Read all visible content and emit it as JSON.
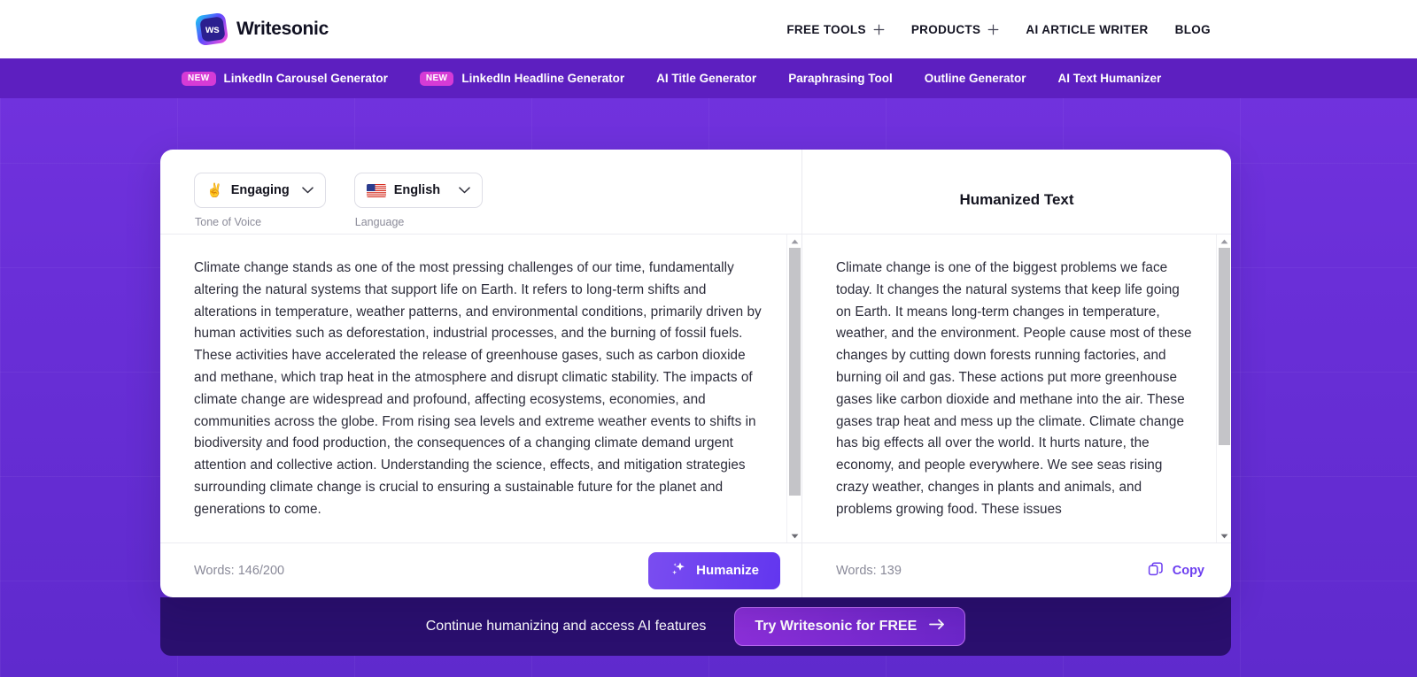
{
  "brand": {
    "name": "Writesonic",
    "logo_text": "ws",
    "logo_icon": "writesonic-logo-icon"
  },
  "topnav": {
    "items": [
      {
        "label": "FREE TOOLS",
        "has_plus": true
      },
      {
        "label": "PRODUCTS",
        "has_plus": true
      },
      {
        "label": "AI ARTICLE WRITER",
        "has_plus": false
      },
      {
        "label": "BLOG",
        "has_plus": false
      }
    ]
  },
  "subnav": {
    "items": [
      {
        "label": "LinkedIn Carousel Generator",
        "badge": "NEW"
      },
      {
        "label": "LinkedIn Headline Generator",
        "badge": "NEW"
      },
      {
        "label": "AI Title Generator",
        "badge": ""
      },
      {
        "label": "Paraphrasing Tool",
        "badge": ""
      },
      {
        "label": "Outline Generator",
        "badge": ""
      },
      {
        "label": "AI Text Humanizer",
        "badge": ""
      }
    ]
  },
  "tool": {
    "tone": {
      "value": "Engaging",
      "emoji": "✌️",
      "caption": "Tone of Voice"
    },
    "language": {
      "value": "English",
      "flag": "us-flag-icon",
      "caption": "Language"
    },
    "input": {
      "text": "Climate change stands as one of the most pressing challenges of our time, fundamentally altering the natural systems that support life on Earth. It refers to long-term shifts and alterations in temperature, weather patterns, and environmental conditions, primarily driven by human activities such as deforestation, industrial processes, and the burning of fossil fuels. These activities have accelerated the release of greenhouse gases, such as carbon dioxide and methane, which trap heat in the atmosphere and disrupt climatic stability. The impacts of climate change are widespread and profound, affecting ecosystems, economies, and communities across the globe. From rising sea levels and extreme weather events to shifts in biodiversity and food production, the consequences of a changing climate demand urgent attention and collective action. Understanding the science, effects, and mitigation strategies surrounding climate change is crucial to ensuring a sustainable future for the planet and generations to come.",
      "word_count": "Words: 146/200",
      "action_label": "Humanize",
      "action_icon": "sparkle-icon"
    },
    "output": {
      "title": "Humanized Text",
      "text": "Climate change is one of the biggest problems we face today. It changes the natural systems that keep life going on Earth. It means long-term changes in temperature, weather, and the environment. People cause most of these changes by cutting down forests running factories, and burning oil and gas. These actions put more greenhouse gases like carbon dioxide and methane into the air. These gases trap heat and mess up the climate. Climate change has big effects all over the world. It hurts nature, the economy, and people everywhere. We see seas rising crazy weather, changes in plants and animals, and problems growing food. These issues",
      "word_count": "Words: 139",
      "copy_label": "Copy",
      "copy_icon": "copy-icon"
    }
  },
  "cta": {
    "text": "Continue humanizing and access AI features",
    "button_label": "Try Writesonic for FREE",
    "button_icon": "arrow-right-icon"
  },
  "colors": {
    "brand_purple": "#6b2fd6",
    "subnav_purple": "#5d1fc0",
    "badge_pink": "#d63bd6",
    "accent_violet": "#6b3df0",
    "cta_navy": "#2a0f6e"
  }
}
